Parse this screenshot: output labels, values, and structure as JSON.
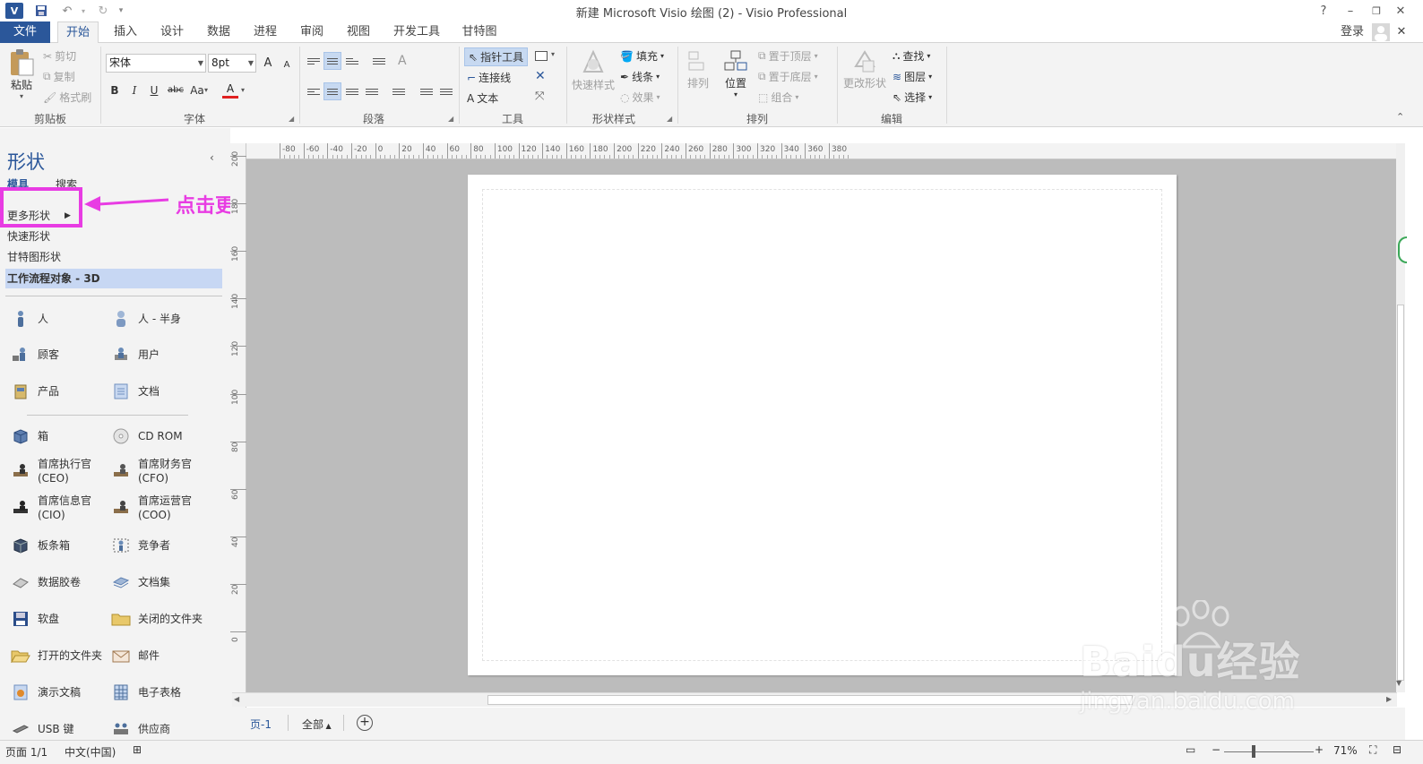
{
  "window": {
    "title": "新建 Microsoft Visio 绘图 (2) - Visio Professional",
    "help": "?",
    "app_icon": "V",
    "signin": "登录"
  },
  "tabs": [
    "文件",
    "开始",
    "插入",
    "设计",
    "数据",
    "进程",
    "审阅",
    "视图",
    "开发工具",
    "甘特图"
  ],
  "ribbon": {
    "clipboard": {
      "paste": "粘贴",
      "cut": "剪切",
      "copy": "复制",
      "format_painter": "格式刷",
      "label": "剪贴板"
    },
    "font": {
      "name": "宋体",
      "size": "8pt",
      "bold": "B",
      "italic": "I",
      "underline": "U",
      "strike": "abc",
      "case": "Aa",
      "color": "A",
      "grow": "A",
      "shrink": "A",
      "label": "字体"
    },
    "paragraph": {
      "label": "段落"
    },
    "tools": {
      "pointer": "指针工具",
      "connector": "连接线",
      "text": "文本",
      "label": "工具"
    },
    "shape_styles": {
      "fill": "填充",
      "line": "线条",
      "effects": "效果",
      "quick_styles": "快速样式",
      "label": "形状样式"
    },
    "arrange": {
      "align": "排列",
      "position": "位置",
      "bring_front": "置于顶层",
      "send_back": "置于底层",
      "group": "组合",
      "label": "排列"
    },
    "editing": {
      "change_shape": "更改形状",
      "find": "查找",
      "layers": "图层",
      "select": "选择",
      "label": "编辑"
    }
  },
  "shapes_panel": {
    "title": "形状",
    "tab_stencils": "模具",
    "tab_search": "搜索",
    "more_shapes": "更多形状",
    "stencils": [
      "快速形状",
      "甘特图形状",
      "工作流程对象 - 3D"
    ],
    "shapes": [
      {
        "name": "人",
        "icon": "person-icon"
      },
      {
        "name": "人 - 半身",
        "icon": "person-half-icon"
      },
      {
        "name": "顾客",
        "icon": "customer-icon"
      },
      {
        "name": "用户",
        "icon": "user-icon"
      },
      {
        "name": "产品",
        "icon": "product-icon"
      },
      {
        "name": "文档",
        "icon": "document-icon"
      },
      {
        "name": "箱",
        "icon": "box-icon"
      },
      {
        "name": "CD ROM",
        "icon": "cd-icon"
      },
      {
        "name": "首席执行官 (CEO)",
        "icon": "ceo-icon"
      },
      {
        "name": "首席财务官 (CFO)",
        "icon": "cfo-icon"
      },
      {
        "name": "首席信息官 (CIO)",
        "icon": "cio-icon"
      },
      {
        "name": "首席运营官 (COO)",
        "icon": "coo-icon"
      },
      {
        "name": "板条箱",
        "icon": "crate-icon"
      },
      {
        "name": "竞争者",
        "icon": "competitor-icon"
      },
      {
        "name": "数据胶卷",
        "icon": "data-tape-icon"
      },
      {
        "name": "文档集",
        "icon": "document-set-icon"
      },
      {
        "name": "软盘",
        "icon": "floppy-icon"
      },
      {
        "name": "关闭的文件夹",
        "icon": "closed-folder-icon"
      },
      {
        "name": "打开的文件夹",
        "icon": "open-folder-icon"
      },
      {
        "name": "邮件",
        "icon": "mail-icon"
      },
      {
        "name": "演示文稿",
        "icon": "presentation-icon"
      },
      {
        "name": "电子表格",
        "icon": "spreadsheet-icon"
      },
      {
        "name": "USB 键",
        "icon": "usb-icon"
      },
      {
        "name": "供应商",
        "icon": "supplier-icon"
      }
    ]
  },
  "hruler_ticks": [
    "-80",
    "-60",
    "-40",
    "-20",
    "0",
    "20",
    "40",
    "60",
    "80",
    "100",
    "120",
    "140",
    "160",
    "180",
    "200",
    "220",
    "240",
    "260",
    "280",
    "300",
    "320",
    "340",
    "360",
    "380"
  ],
  "vruler_ticks": [
    "200",
    "180",
    "160",
    "140",
    "120",
    "100",
    "80",
    "60",
    "40",
    "20",
    "0"
  ],
  "page_tabs": {
    "page": "页-1",
    "all": "全部"
  },
  "status": {
    "page": "页面 1/1",
    "language": "中文(中国)",
    "zoom": "71%"
  },
  "annotation": {
    "text": "点击更多形状"
  },
  "watermark": {
    "brand": "Baidu经验",
    "url": "jingyan.baidu.com"
  },
  "colors": {
    "accent": "#2b579a",
    "annotation": "#e83ce3"
  }
}
